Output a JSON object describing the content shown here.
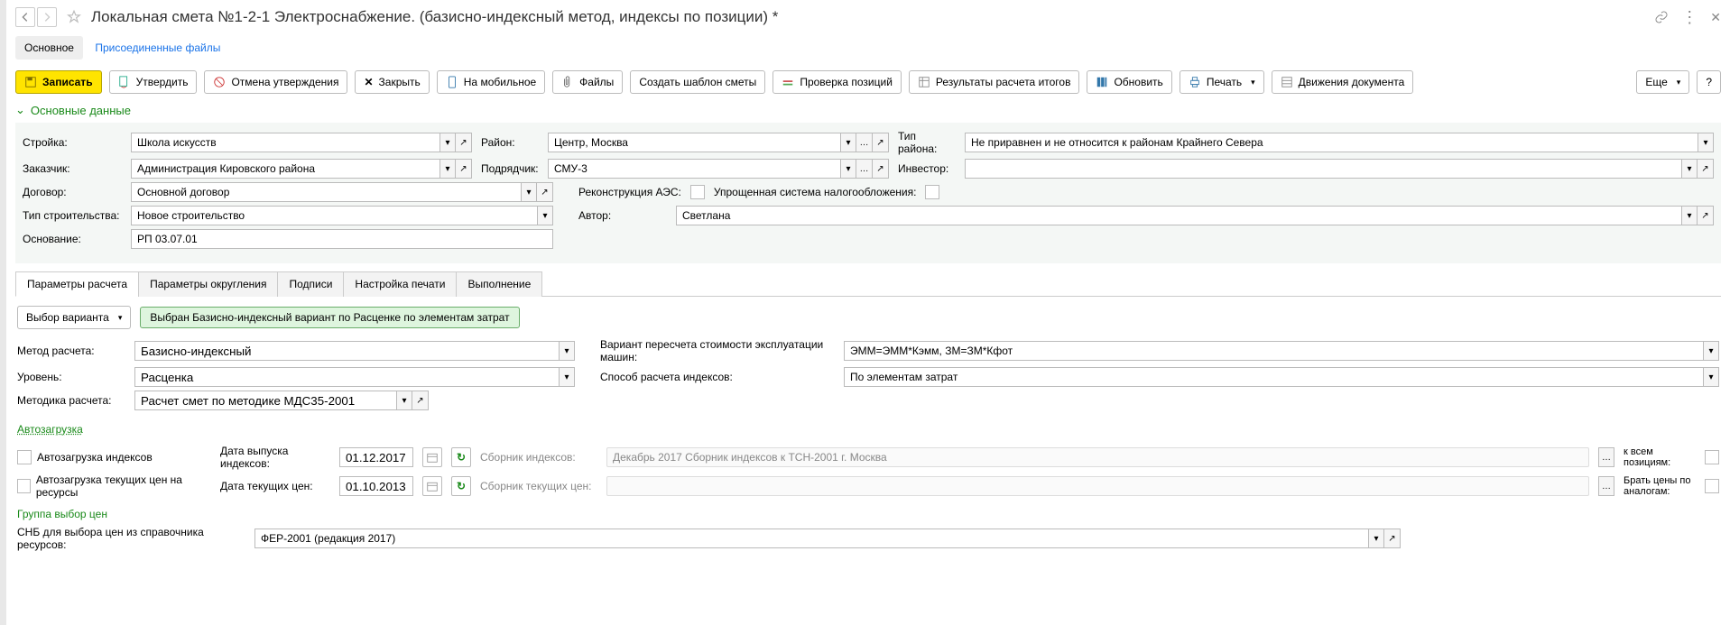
{
  "title": "Локальная смета №1-2-1 Электроснабжение. (базисно-индексный метод, индексы по позиции) *",
  "subtabs": {
    "main": "Основное",
    "files": "Присоединенные файлы"
  },
  "toolbar": {
    "save": "Записать",
    "approve": "Утвердить",
    "unapprove": "Отмена утверждения",
    "close": "Закрыть",
    "mobile": "На мобильное",
    "files": "Файлы",
    "template": "Создать шаблон сметы",
    "check": "Проверка позиций",
    "results": "Результаты расчета итогов",
    "refresh": "Обновить",
    "print": "Печать",
    "moves": "Движения документа",
    "more": "Еще",
    "help": "?"
  },
  "section_main": "Основные данные",
  "labels": {
    "stroyka": "Стройка:",
    "zakazchik": "Заказчик:",
    "dogovor": "Договор:",
    "tipstroy": "Тип строительства:",
    "osn": "Основание:",
    "rayon": "Район:",
    "podr": "Подрядчик:",
    "rekon": "Реконструкция АЭС:",
    "usn": "Упрощенная система налогообложения:",
    "author": "Автор:",
    "tipray": "Тип района:",
    "investor": "Инвестор:"
  },
  "values": {
    "stroyka": "Школа искусств",
    "zakazchik": "Администрация Кировского района",
    "dogovor": "Основной договор",
    "tipstroy": "Новое строительство",
    "osn": "РП 03.07.01",
    "rayon": "Центр, Москва",
    "podr": "СМУ-3",
    "author": "Светлана",
    "tipray": "Не приравнен и не относится к районам Крайнего Севера"
  },
  "ptabs": [
    "Параметры расчета",
    "Параметры округления",
    "Подписи",
    "Настройка печати",
    "Выполнение"
  ],
  "variant": {
    "btn": "Выбор варианта",
    "badge": "Выбран Базисно-индексный вариант по Расценке по элементам затрат"
  },
  "params": {
    "method_l": "Метод расчета:",
    "method_v": "Базисно-индексный",
    "level_l": "Уровень:",
    "level_v": "Расценка",
    "metod_l": "Методика расчета:",
    "metod_v": "Расчет смет по методике МДС35-2001",
    "var_l": "Вариант пересчета стоимости эксплуатации машин:",
    "var_v": "ЭММ=ЭММ*Кэмм, ЗМ=ЗМ*Кфот",
    "way_l": "Способ расчета индексов:",
    "way_v": "По элементам затрат"
  },
  "auto": {
    "head": "Автозагрузка",
    "idx_chk": "Автозагрузка индексов",
    "cur_chk": "Автозагрузка текущих цен на ресурсы",
    "idx_date_l": "Дата выпуска индексов:",
    "idx_date_v": "01.12.2017",
    "cur_date_l": "Дата текущих цен:",
    "cur_date_v": "01.10.2013",
    "idx_coll_l": "Сборник индексов:",
    "idx_coll_v": "Декабрь 2017 Сборник индексов к ТСН-2001 г. Москва",
    "cur_coll_l": "Сборник текущих цен:",
    "all_pos": "к всем позициям:",
    "analog": "Брать цены по аналогам:"
  },
  "grp": {
    "head": "Группа выбор цен",
    "snb_l": "СНБ для выбора цен из справочника ресурсов:",
    "snb_v": "ФЕР-2001 (редакция 2017)"
  }
}
